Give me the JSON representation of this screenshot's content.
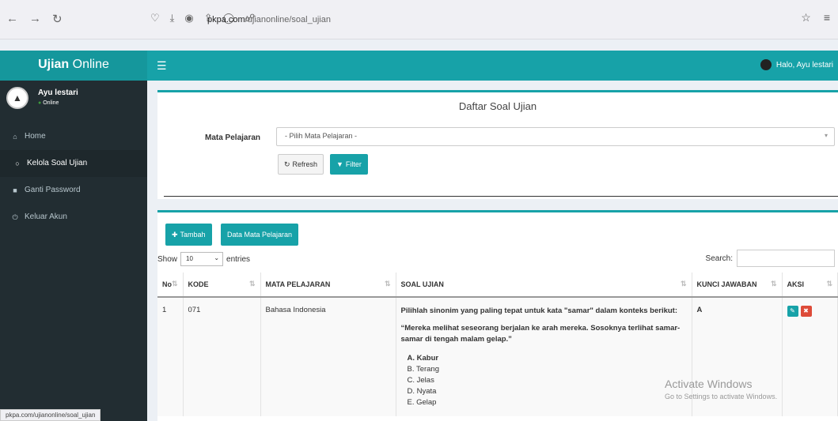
{
  "browser": {
    "url_domain": "pkpa.com",
    "url_path": "/ujianonline/soal_ujian",
    "status_url": "pkpa.com/ujianonline/soal_ujian"
  },
  "header": {
    "brand_bold": "Ujian",
    "brand_rest": " Online",
    "user_greeting": "Halo, Ayu lestari"
  },
  "sidebar": {
    "user_name": "Ayu lestari",
    "user_status": "Online",
    "items": [
      {
        "label": "Home",
        "icon": "home-icon"
      },
      {
        "label": "Kelola Soal Ujian",
        "icon": "circle-icon"
      },
      {
        "label": "Ganti Password",
        "icon": "lock-icon"
      },
      {
        "label": "Keluar Akun",
        "icon": "power-icon"
      }
    ]
  },
  "filter_box": {
    "title": "Daftar Soal Ujian",
    "label": "Mata Pelajaran",
    "select_value": "- Pilih Mata Pelajaran -",
    "refresh_label": "Refresh",
    "filter_label": "Filter"
  },
  "table_box": {
    "tambah_label": "Tambah",
    "data_mapel_label": "Data Mata Pelajaran",
    "show_label": "Show",
    "entries_value": "10",
    "entries_label": "entries",
    "search_label": "Search:",
    "columns": [
      "No",
      "KODE",
      "MATA PELAJARAN",
      "SOAL UJIAN",
      "KUNCI JAWABAN",
      "AKSI"
    ],
    "rows": [
      {
        "no": "1",
        "kode": "071",
        "mapel": "Bahasa Indonesia",
        "soal_q": "Pilihlah sinonim yang paling tepat untuk kata \"samar\" dalam konteks berikut:",
        "soal_ctx": "“Mereka melihat seseorang berjalan ke arah mereka. Sosoknya terlihat samar-samar di tengah malam gelap.”",
        "options": [
          "A. Kabur",
          "B. Terang",
          "C. Jelas",
          "D. Nyata",
          "E. Gelap"
        ],
        "kunci": "A"
      }
    ]
  },
  "watermark": {
    "line1": "Activate Windows",
    "line2": "Go to Settings to activate Windows."
  },
  "colors": {
    "accent": "#17a2a8",
    "sidebar_bg": "#222d32",
    "danger": "#dd4b39"
  }
}
